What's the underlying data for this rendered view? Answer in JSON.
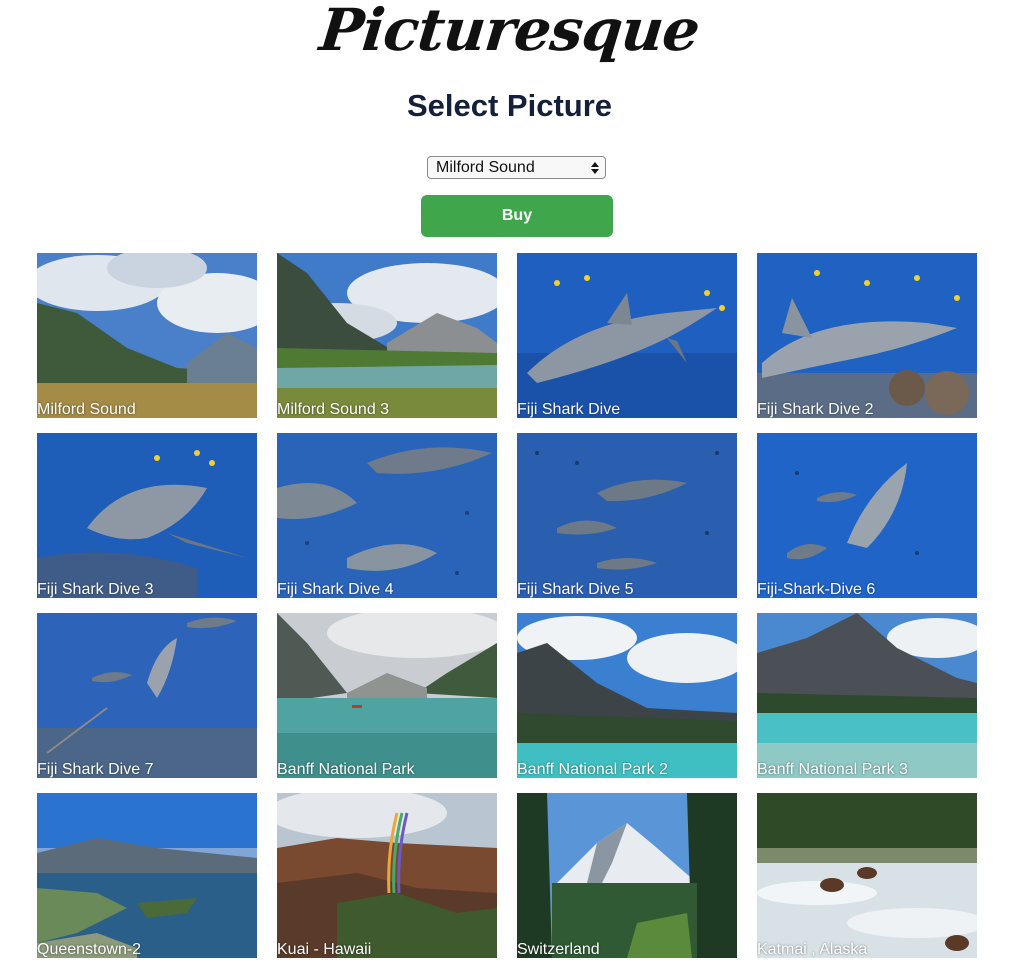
{
  "header": {
    "brand": "Picturesque",
    "title": "Select Picture"
  },
  "picker": {
    "selected": "Milford Sound",
    "buy_label": "Buy"
  },
  "colors": {
    "buy_button": "#3fa64c",
    "heading": "#14203a"
  },
  "gallery": {
    "items": [
      {
        "caption": "Milford Sound"
      },
      {
        "caption": "Milford Sound 3"
      },
      {
        "caption": "Fiji Shark Dive"
      },
      {
        "caption": "Fiji Shark Dive 2"
      },
      {
        "caption": "Fiji Shark Dive 3"
      },
      {
        "caption": "Fiji Shark Dive 4"
      },
      {
        "caption": "Fiji Shark Dive 5"
      },
      {
        "caption": "Fiji-Shark-Dive 6"
      },
      {
        "caption": "Fiji Shark Dive 7"
      },
      {
        "caption": "Banff National Park"
      },
      {
        "caption": "Banff National Park 2"
      },
      {
        "caption": "Banff National Park 3"
      },
      {
        "caption": "Queenstown-2"
      },
      {
        "caption": "Kuai - Hawaii"
      },
      {
        "caption": "Switzerland"
      },
      {
        "caption": "Katmai , Alaska"
      }
    ]
  }
}
